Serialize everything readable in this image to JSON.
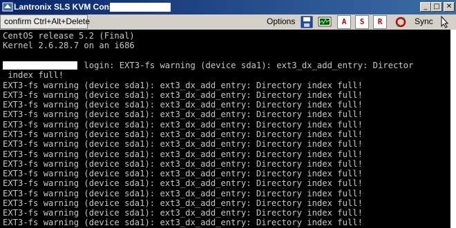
{
  "window": {
    "title": "Lantronix SLS KVM Console -",
    "minimize_glyph": "_",
    "maximize_glyph": "□",
    "close_glyph": "✕"
  },
  "toolbar": {
    "cad_label": "confirm Ctrl+Alt+Delete",
    "options_label": "Options",
    "letter_a": "A",
    "letter_s": "S",
    "letter_r": "R",
    "sync_label": "Sync"
  },
  "console": {
    "header_lines": [
      "CentOS release 5.2 (Final)",
      "Kernel 2.6.28.7 on an i686"
    ],
    "login_line": "                login: EXT3-fs warning (device sda1): ext3_dx_add_entry: Director",
    "login_wrap": " index full!",
    "warning_lines": [
      "EXT3-fs warning (device sda1): ext3_dx_add_entry: Directory index full!",
      "EXT3-fs warning (device sda1): ext3_dx_add_entry: Directory index full!",
      "EXT3-fs warning (device sda1): ext3_dx_add_entry: Directory index full!",
      "EXT3-fs warning (device sda1): ext3_dx_add_entry: Directory index full!",
      "EXT3-fs warning (device sda1): ext3_dx_add_entry: Directory index full!",
      "EXT3-fs warning (device sda1): ext3_dx_add_entry: Directory index full!",
      "EXT3-fs warning (device sda1): ext3_dx_add_entry: Directory index full!",
      "EXT3-fs warning (device sda1): ext3_dx_add_entry: Directory index full!",
      "EXT3-fs warning (device sda1): ext3_dx_add_entry: Directory index full!",
      "EXT3-fs warning (device sda1): ext3_dx_add_entry: Directory index full!",
      "EXT3-fs warning (device sda1): ext3_dx_add_entry: Directory index full!",
      "EXT3-fs warning (device sda1): ext3_dx_add_entry: Directory index full!",
      "EXT3-fs warning (device sda1): ext3_dx_add_entry: Directory index full!",
      "EXT3-fs warning (device sda1): ext3_dx_add_entry: Directory index full!",
      "EXT3-fs warning (device sda1): ext3_dx_add_entry: Directory index full!"
    ],
    "text_color": "#c8c8c8",
    "background": "#000000"
  },
  "icons": [
    "lantronix-logo-icon",
    "save-disk-icon",
    "monitor-graph-icon",
    "sync-arrows-icon",
    "pointer-icon"
  ]
}
